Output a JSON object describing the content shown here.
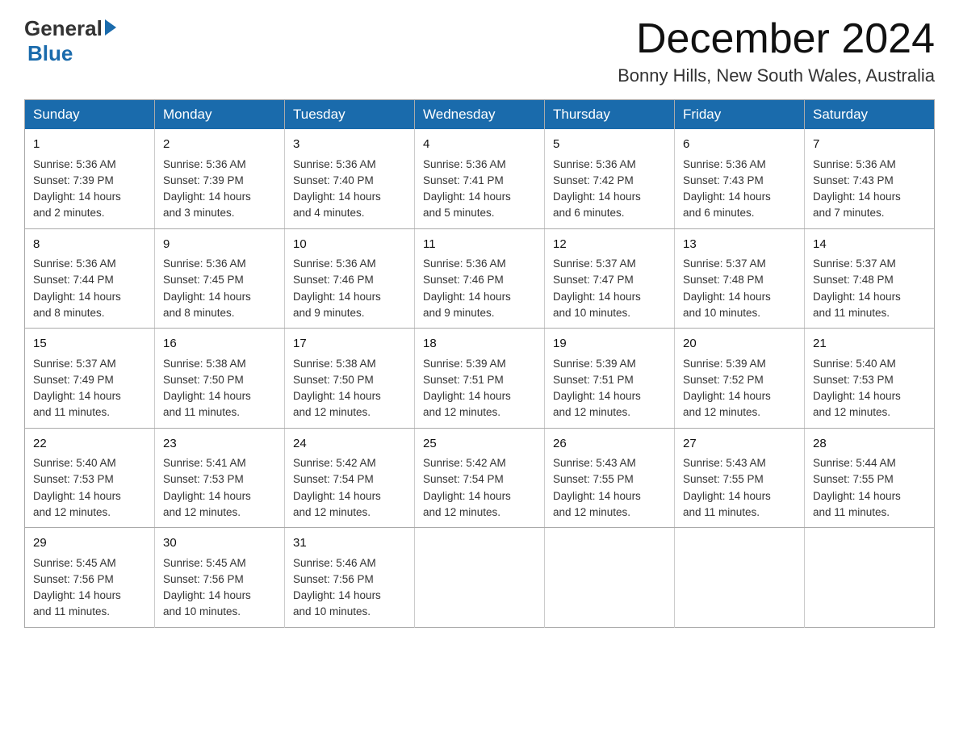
{
  "header": {
    "logo_general": "General",
    "logo_blue": "Blue",
    "month_title": "December 2024",
    "location": "Bonny Hills, New South Wales, Australia"
  },
  "weekdays": [
    "Sunday",
    "Monday",
    "Tuesday",
    "Wednesday",
    "Thursday",
    "Friday",
    "Saturday"
  ],
  "weeks": [
    [
      {
        "day": "1",
        "sunrise": "5:36 AM",
        "sunset": "7:39 PM",
        "daylight": "14 hours and 2 minutes."
      },
      {
        "day": "2",
        "sunrise": "5:36 AM",
        "sunset": "7:39 PM",
        "daylight": "14 hours and 3 minutes."
      },
      {
        "day": "3",
        "sunrise": "5:36 AM",
        "sunset": "7:40 PM",
        "daylight": "14 hours and 4 minutes."
      },
      {
        "day": "4",
        "sunrise": "5:36 AM",
        "sunset": "7:41 PM",
        "daylight": "14 hours and 5 minutes."
      },
      {
        "day": "5",
        "sunrise": "5:36 AM",
        "sunset": "7:42 PM",
        "daylight": "14 hours and 6 minutes."
      },
      {
        "day": "6",
        "sunrise": "5:36 AM",
        "sunset": "7:43 PM",
        "daylight": "14 hours and 6 minutes."
      },
      {
        "day": "7",
        "sunrise": "5:36 AM",
        "sunset": "7:43 PM",
        "daylight": "14 hours and 7 minutes."
      }
    ],
    [
      {
        "day": "8",
        "sunrise": "5:36 AM",
        "sunset": "7:44 PM",
        "daylight": "14 hours and 8 minutes."
      },
      {
        "day": "9",
        "sunrise": "5:36 AM",
        "sunset": "7:45 PM",
        "daylight": "14 hours and 8 minutes."
      },
      {
        "day": "10",
        "sunrise": "5:36 AM",
        "sunset": "7:46 PM",
        "daylight": "14 hours and 9 minutes."
      },
      {
        "day": "11",
        "sunrise": "5:36 AM",
        "sunset": "7:46 PM",
        "daylight": "14 hours and 9 minutes."
      },
      {
        "day": "12",
        "sunrise": "5:37 AM",
        "sunset": "7:47 PM",
        "daylight": "14 hours and 10 minutes."
      },
      {
        "day": "13",
        "sunrise": "5:37 AM",
        "sunset": "7:48 PM",
        "daylight": "14 hours and 10 minutes."
      },
      {
        "day": "14",
        "sunrise": "5:37 AM",
        "sunset": "7:48 PM",
        "daylight": "14 hours and 11 minutes."
      }
    ],
    [
      {
        "day": "15",
        "sunrise": "5:37 AM",
        "sunset": "7:49 PM",
        "daylight": "14 hours and 11 minutes."
      },
      {
        "day": "16",
        "sunrise": "5:38 AM",
        "sunset": "7:50 PM",
        "daylight": "14 hours and 11 minutes."
      },
      {
        "day": "17",
        "sunrise": "5:38 AM",
        "sunset": "7:50 PM",
        "daylight": "14 hours and 12 minutes."
      },
      {
        "day": "18",
        "sunrise": "5:39 AM",
        "sunset": "7:51 PM",
        "daylight": "14 hours and 12 minutes."
      },
      {
        "day": "19",
        "sunrise": "5:39 AM",
        "sunset": "7:51 PM",
        "daylight": "14 hours and 12 minutes."
      },
      {
        "day": "20",
        "sunrise": "5:39 AM",
        "sunset": "7:52 PM",
        "daylight": "14 hours and 12 minutes."
      },
      {
        "day": "21",
        "sunrise": "5:40 AM",
        "sunset": "7:53 PM",
        "daylight": "14 hours and 12 minutes."
      }
    ],
    [
      {
        "day": "22",
        "sunrise": "5:40 AM",
        "sunset": "7:53 PM",
        "daylight": "14 hours and 12 minutes."
      },
      {
        "day": "23",
        "sunrise": "5:41 AM",
        "sunset": "7:53 PM",
        "daylight": "14 hours and 12 minutes."
      },
      {
        "day": "24",
        "sunrise": "5:42 AM",
        "sunset": "7:54 PM",
        "daylight": "14 hours and 12 minutes."
      },
      {
        "day": "25",
        "sunrise": "5:42 AM",
        "sunset": "7:54 PM",
        "daylight": "14 hours and 12 minutes."
      },
      {
        "day": "26",
        "sunrise": "5:43 AM",
        "sunset": "7:55 PM",
        "daylight": "14 hours and 12 minutes."
      },
      {
        "day": "27",
        "sunrise": "5:43 AM",
        "sunset": "7:55 PM",
        "daylight": "14 hours and 11 minutes."
      },
      {
        "day": "28",
        "sunrise": "5:44 AM",
        "sunset": "7:55 PM",
        "daylight": "14 hours and 11 minutes."
      }
    ],
    [
      {
        "day": "29",
        "sunrise": "5:45 AM",
        "sunset": "7:56 PM",
        "daylight": "14 hours and 11 minutes."
      },
      {
        "day": "30",
        "sunrise": "5:45 AM",
        "sunset": "7:56 PM",
        "daylight": "14 hours and 10 minutes."
      },
      {
        "day": "31",
        "sunrise": "5:46 AM",
        "sunset": "7:56 PM",
        "daylight": "14 hours and 10 minutes."
      },
      null,
      null,
      null,
      null
    ]
  ],
  "labels": {
    "sunrise": "Sunrise:",
    "sunset": "Sunset:",
    "daylight": "Daylight:"
  }
}
